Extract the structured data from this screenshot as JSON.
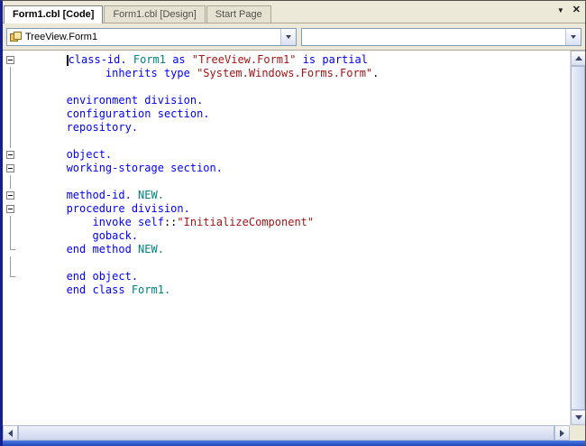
{
  "tabs": {
    "items": [
      {
        "label": "Form1.cbl [Code]",
        "state": "active"
      },
      {
        "label": "Form1.cbl [Design]",
        "state": "inactive"
      },
      {
        "label": "Start Page",
        "state": "inactive"
      }
    ],
    "menu_glyph": "▼",
    "close_glyph": "✕"
  },
  "navigation_bar": {
    "types_dropdown": {
      "value": "TreeView.Form1",
      "icon": "class-icon"
    },
    "members_dropdown": {
      "value": ""
    }
  },
  "editor": {
    "syntax_colors": {
      "keyword": "#0000ff",
      "identifier": "#008080",
      "string": "#a31515",
      "plain": "#000000"
    },
    "lines": [
      {
        "fold": "minus",
        "segments": [
          [
            "plain",
            "       "
          ],
          [
            "caret",
            ""
          ],
          [
            "keyword",
            "class-id."
          ],
          [
            "plain",
            " "
          ],
          [
            "identifier",
            "Form1"
          ],
          [
            "keyword",
            " as "
          ],
          [
            "string",
            "\"TreeView.Form1\""
          ],
          [
            "keyword",
            " is partial"
          ]
        ]
      },
      {
        "fold": "line",
        "segments": [
          [
            "keyword",
            "             inherits type "
          ],
          [
            "string",
            "\"System.Windows.Forms.Form\""
          ],
          [
            "plain",
            "."
          ]
        ]
      },
      {
        "fold": "line",
        "segments": []
      },
      {
        "fold": "line",
        "segments": [
          [
            "keyword",
            "       environment division."
          ]
        ]
      },
      {
        "fold": "line",
        "segments": [
          [
            "keyword",
            "       configuration section."
          ]
        ]
      },
      {
        "fold": "line",
        "segments": [
          [
            "keyword",
            "       repository."
          ]
        ]
      },
      {
        "fold": "line",
        "segments": []
      },
      {
        "fold": "minus",
        "segments": [
          [
            "keyword",
            "       object."
          ]
        ]
      },
      {
        "fold": "minus",
        "segments": [
          [
            "keyword",
            "       working-storage section."
          ]
        ]
      },
      {
        "fold": "line",
        "segments": []
      },
      {
        "fold": "minus",
        "segments": [
          [
            "keyword",
            "       method-id. "
          ],
          [
            "identifier",
            "NEW."
          ]
        ]
      },
      {
        "fold": "minus",
        "segments": [
          [
            "keyword",
            "       procedure division."
          ]
        ]
      },
      {
        "fold": "line",
        "segments": [
          [
            "keyword",
            "           invoke self"
          ],
          [
            "plain",
            "::"
          ],
          [
            "string",
            "\"InitializeComponent\""
          ]
        ]
      },
      {
        "fold": "line",
        "segments": [
          [
            "keyword",
            "           goback."
          ]
        ]
      },
      {
        "fold": "end",
        "segments": [
          [
            "keyword",
            "       end method "
          ],
          [
            "identifier",
            "NEW."
          ]
        ]
      },
      {
        "fold": "line",
        "segments": []
      },
      {
        "fold": "end",
        "segments": [
          [
            "keyword",
            "       end object."
          ]
        ]
      },
      {
        "fold": "none",
        "segments": [
          [
            "keyword",
            "       end class "
          ],
          [
            "identifier",
            "Form1."
          ]
        ]
      }
    ]
  }
}
